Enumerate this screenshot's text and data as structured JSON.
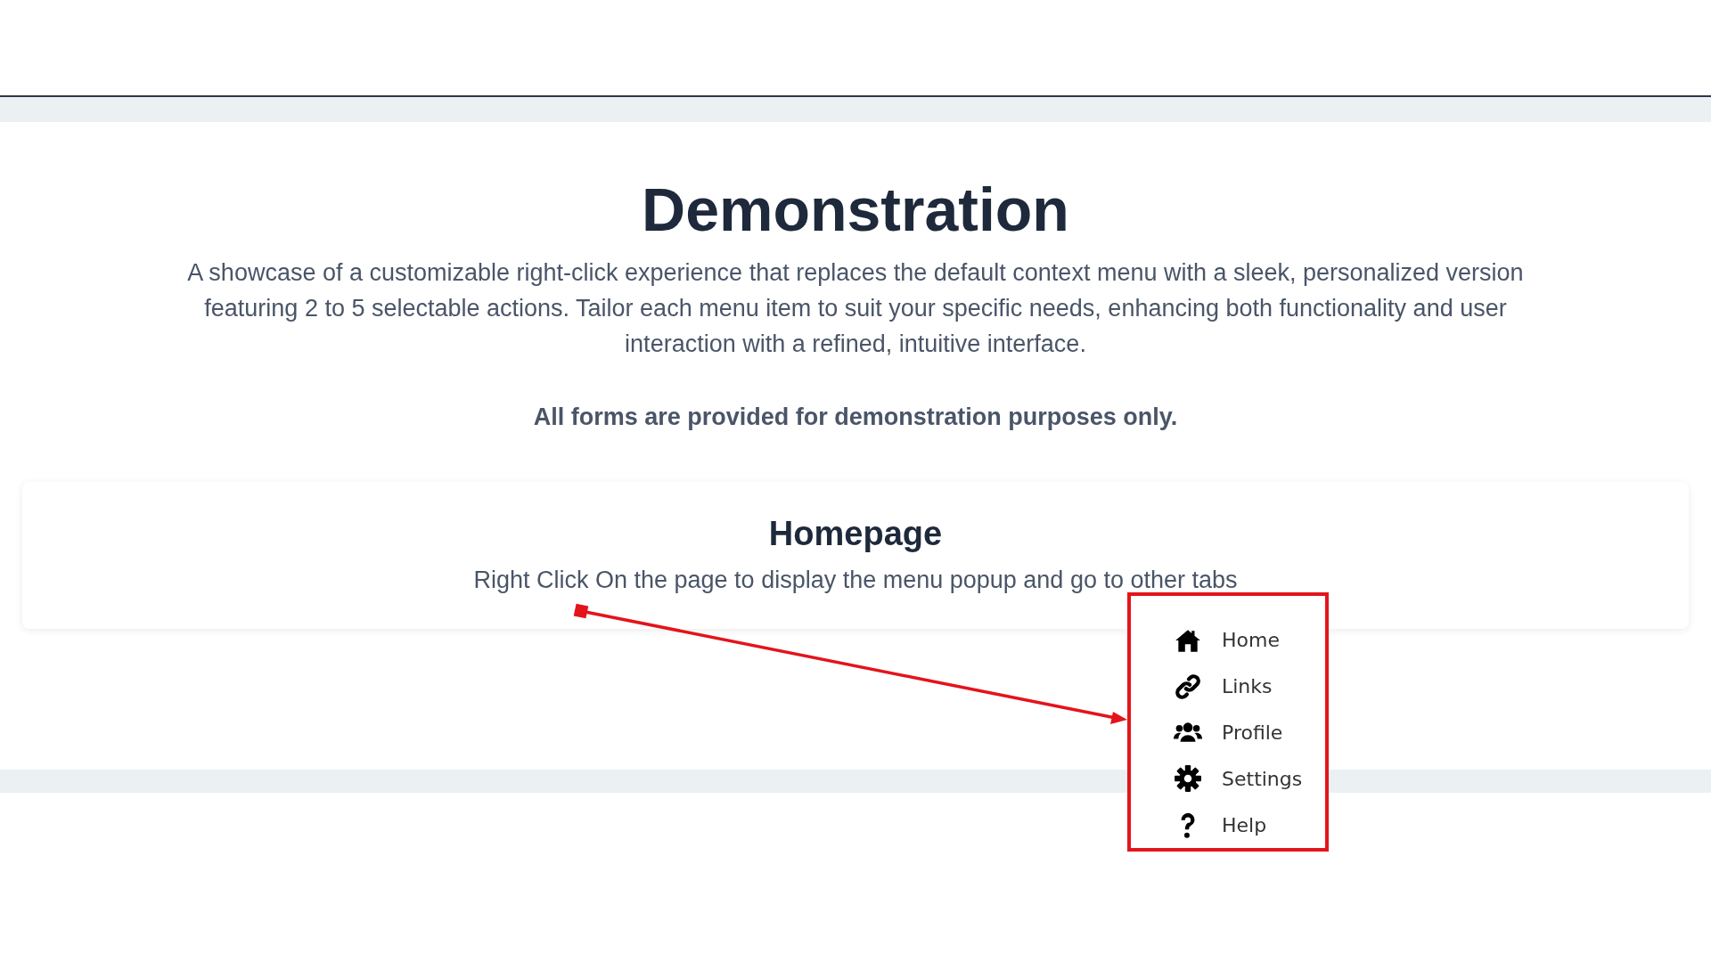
{
  "title": "Demonstration",
  "description": "A showcase of a customizable right-click experience that replaces the default context menu with a sleek, personalized version featuring 2 to 5 selectable actions. Tailor each menu item to suit your specific needs, enhancing both functionality and user interaction with a refined, intuitive interface.",
  "note": "All forms are provided for demonstration purposes only.",
  "card": {
    "title": "Homepage",
    "text": "Right Click On the page to display the menu popup and go to other tabs"
  },
  "menu": {
    "items": [
      {
        "label": "Home",
        "kind": "home"
      },
      {
        "label": "Links",
        "kind": "link"
      },
      {
        "label": "Profile",
        "kind": "users"
      },
      {
        "label": "Settings",
        "kind": "gear"
      },
      {
        "label": "Help",
        "kind": "help"
      }
    ]
  }
}
